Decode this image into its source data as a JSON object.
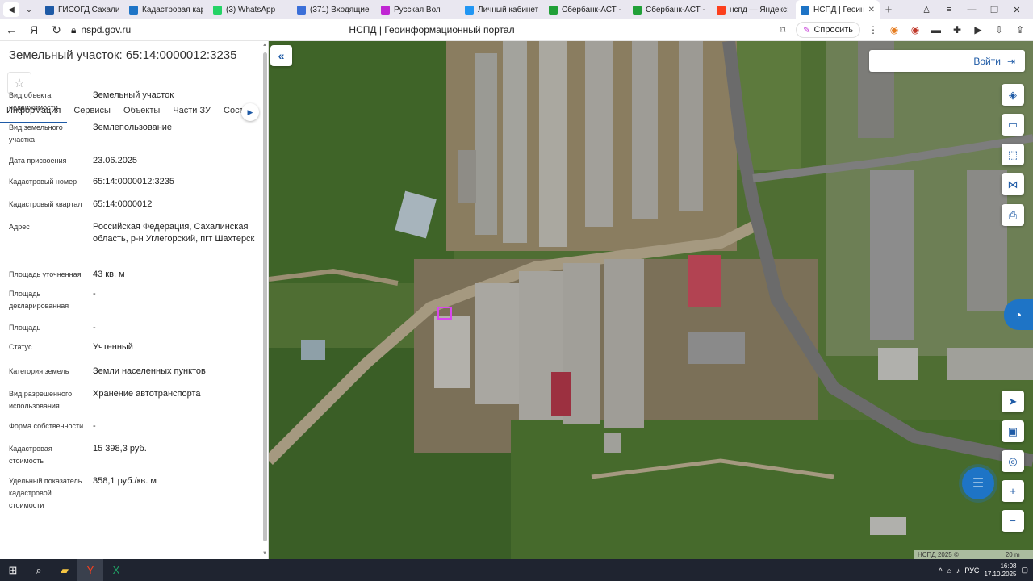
{
  "browser": {
    "tabs": [
      {
        "title": "ГИСОГД Сахалин",
        "color": "#1e5aa6",
        "active": false
      },
      {
        "title": "Кадастровая карт",
        "color": "#1e74c6",
        "active": false
      },
      {
        "title": "(3) WhatsApp",
        "color": "#25d366",
        "active": false
      },
      {
        "title": "(371) Входящие -",
        "color": "#3b6fd8",
        "active": false
      },
      {
        "title": "Русская Вол",
        "color": "#c026d3",
        "active": false
      },
      {
        "title": "Личный кабинет",
        "color": "#2196f3",
        "active": false
      },
      {
        "title": "Сбербанк-АСТ - Э",
        "color": "#21a038",
        "active": false
      },
      {
        "title": "Сбербанк-АСТ - Э",
        "color": "#21a038",
        "active": false
      },
      {
        "title": "нспд — Яндекс: на",
        "color": "#fc3f1d",
        "active": false
      },
      {
        "title": "НСПД | Геоинф",
        "color": "#1e74c6",
        "active": true
      }
    ],
    "url": "nspd.gov.ru",
    "page_title": "НСПД | Геоинформационный портал",
    "ask_label": "Спросить"
  },
  "panel": {
    "title": "Земельный участок: 65:14:0000012:3235",
    "tabs": [
      "Информация",
      "Сервисы",
      "Объекты",
      "Части ЗУ",
      "Соста"
    ],
    "properties": [
      {
        "label": "Вид объекта недвижимости",
        "value": "Земельный участок"
      },
      {
        "label": "Вид земельного участка",
        "value": "Землепользование"
      },
      {
        "label": "Дата присвоения",
        "value": "23.06.2025"
      },
      {
        "label": "Кадастровый номер",
        "value": "65:14:0000012:3235"
      },
      {
        "label": "Кадастровый квартал",
        "value": "65:14:0000012"
      },
      {
        "label": "Адрес",
        "value": "Российская Федерация, Сахалинская область, р-н Углегорский, пгт Шахтерск"
      },
      {
        "label": "Площадь уточненная",
        "value": "43 кв. м"
      },
      {
        "label": "Площадь декларированная",
        "value": "-"
      },
      {
        "label": "Площадь",
        "value": "-"
      },
      {
        "label": "Статус",
        "value": "Учтенный"
      },
      {
        "label": "Категория земель",
        "value": "Земли населенных пунктов"
      },
      {
        "label": "Вид разрешенного использования",
        "value": "Хранение автотранспорта"
      },
      {
        "label": "Форма собственности",
        "value": "-"
      },
      {
        "label": "Кадастровая стоимость",
        "value": "15 398,3 руб."
      },
      {
        "label": "Удельный показатель кадастровой стоимости",
        "value": "358,1 руб./кв. м"
      }
    ]
  },
  "map": {
    "login_label": "Войти",
    "copyright": "НСПД 2025 ©",
    "scale": "20 m"
  },
  "taskbar": {
    "lang": "РУС",
    "time": "16:08",
    "date": "17.10.2025"
  }
}
